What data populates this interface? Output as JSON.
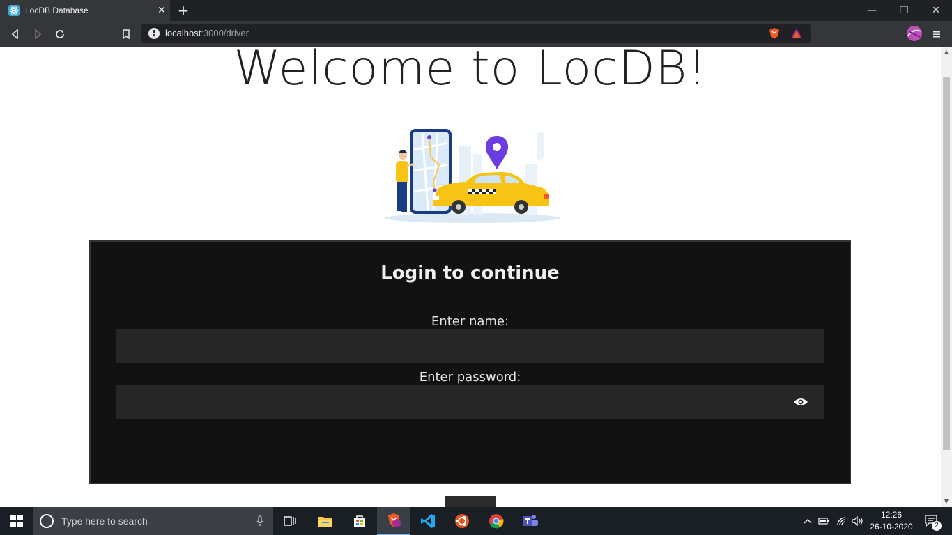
{
  "browser": {
    "tab_title": "LocDB Database",
    "tab_close": "✕",
    "new_tab": "+",
    "url_host": "localhost",
    "url_path": ":3000/driver",
    "window_controls": {
      "minimize": "—",
      "restore": "❐",
      "close": "✕"
    },
    "accent_color": "#35363a"
  },
  "page": {
    "welcome": "Welcome to LocDB!",
    "hero_image": "taxi-location-illustration"
  },
  "login": {
    "heading": "Login to continue",
    "name_label": "Enter name:",
    "name_value": "",
    "password_label": "Enter password:",
    "password_value": ""
  },
  "taskbar": {
    "search_placeholder": "Type here to search",
    "time": "12:26",
    "date": "26-10-2020",
    "notification_count": "2",
    "apps": [
      "task-view",
      "file-explorer",
      "microsoft-store",
      "brave-browser",
      "vs-code",
      "ubuntu",
      "chrome",
      "teams"
    ]
  },
  "colors": {
    "card_bg": "#121212",
    "input_bg": "#262626",
    "taxi_yellow": "#f7c415",
    "pin_purple": "#6c3ce0"
  }
}
